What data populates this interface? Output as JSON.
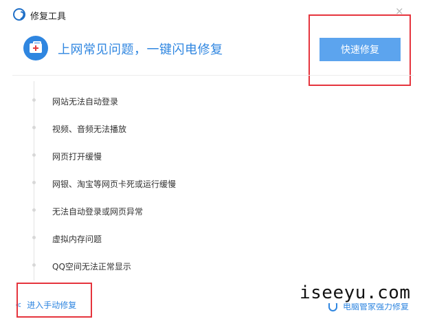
{
  "window": {
    "title": "修复工具",
    "close_glyph": "×"
  },
  "hero": {
    "icon": "first-aid-kit-icon",
    "text": "上网常见问题，一键闪电修复",
    "quick_fix_label": "快速修复"
  },
  "issues": [
    "网站无法自动登录",
    "视频、音频无法播放",
    "网页打开缓慢",
    "网银、淘宝等网页卡死或运行缓慢",
    "无法自动登录或网页异常",
    "虚拟内存问题",
    "QQ空间无法正常显示"
  ],
  "footer": {
    "manual_label": "进入手动修复",
    "system_fix_label": "电脑管家强力修复"
  },
  "watermark": "iseeyu.com",
  "colors": {
    "accent": "#2f86e0",
    "button": "#5ca4ee",
    "highlight_box": "#e5333c"
  }
}
